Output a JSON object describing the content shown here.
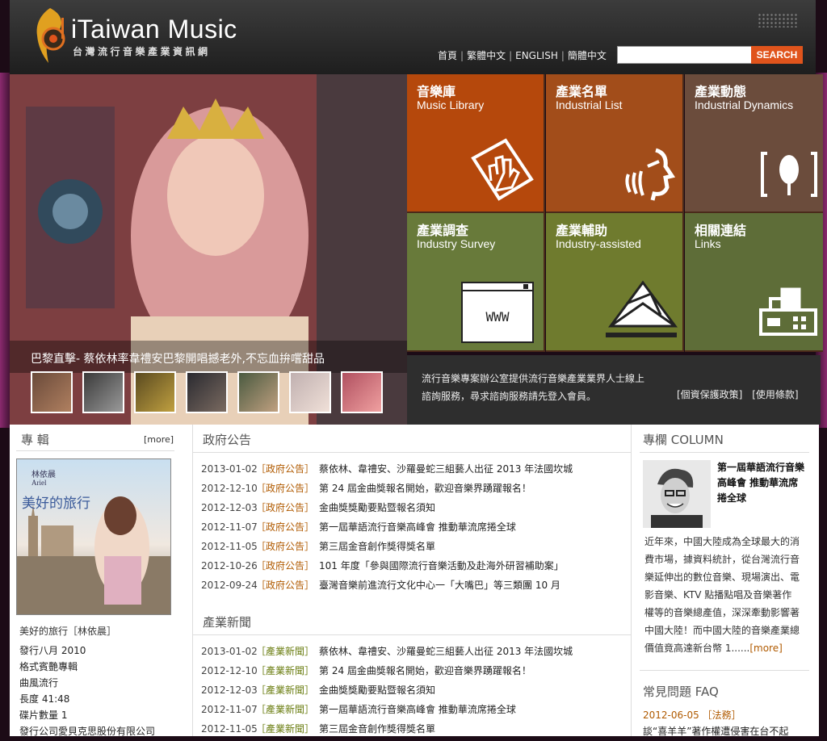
{
  "header": {
    "logo_title": "iTaiwan Music",
    "logo_subtitle": "台灣流行音樂產業資訊網",
    "nav": [
      "首頁",
      "繁體中文",
      "ENGLISH",
      "簡體中文"
    ],
    "search_placeholder": "",
    "search_button": "SEARCH"
  },
  "hero": {
    "caption": "巴黎直擊- 蔡依林率韋禮安巴黎開唱撼老外,不忘血拚嚐甜品",
    "thumbnail_count": 7
  },
  "tiles": [
    {
      "zh": "音樂庫",
      "en": "Music Library",
      "color": "#b5480c",
      "icon": "hand-icon"
    },
    {
      "zh": "產業名單",
      "en": "Industrial List",
      "color": "#a24d1a",
      "icon": "speaker-voice-icon"
    },
    {
      "zh": "產業動態",
      "en": "Industrial Dynamics",
      "color": "#6b4c3c",
      "icon": "tree-frame-icon"
    },
    {
      "zh": "產業調查",
      "en": "Industry Survey",
      "color": "#687a3a",
      "icon": "www-window-icon"
    },
    {
      "zh": "產業輔助",
      "en": "Industry-assisted",
      "color": "#6f7b2e",
      "icon": "envelope-paper-icon"
    },
    {
      "zh": "相關連結",
      "en": "Links",
      "color": "#5e6d38",
      "icon": "fax-printer-icon"
    }
  ],
  "info_bar": {
    "text": "流行音樂專案辦公室提供流行音樂產業業界人士線上諮詢服務，尋求諮詢服務請先登入會員。",
    "privacy": "[個資保護政策]",
    "terms": "[使用條款]"
  },
  "album": {
    "section_title": "專 輯",
    "more": "[more]",
    "cover_artist": "林依晨",
    "cover_en": "Ariel",
    "cover_title": "美好的旅行",
    "title": "美好的旅行［林依晨］",
    "details": [
      "發行八月 2010",
      "格式賓艷專輯",
      "曲風流行",
      "長度 41:48",
      "碟片數量 1",
      "發行公司愛貝克思股份有限公司"
    ]
  },
  "gov_notices": {
    "section_title": "政府公告",
    "tag": "［政府公告］",
    "items": [
      {
        "date": "2013-01-02",
        "title": "蔡依林、韋禮安、沙羅曼蛇三組藝人出征 2013 年法國坎城"
      },
      {
        "date": "2012-12-10",
        "title": "第 24 屆金曲獎報名開始，歡迎音樂界踴躍報名！"
      },
      {
        "date": "2012-12-03",
        "title": "金曲獎獎勵要點暨報名須知"
      },
      {
        "date": "2012-11-07",
        "title": "第一屆華語流行音樂高峰會 推動華流席捲全球"
      },
      {
        "date": "2012-11-05",
        "title": "第三屆金音創作獎得獎名單"
      },
      {
        "date": "2012-10-26",
        "title": "101 年度「參與國際流行音樂活動及赴海外研習補助案」"
      },
      {
        "date": "2012-09-24",
        "title": "臺灣音樂前進流行文化中心一「大嘴巴」等三類團 10 月"
      }
    ]
  },
  "industry_news": {
    "section_title": "產業新聞",
    "tag": "［產業新聞］",
    "items": [
      {
        "date": "2013-01-02",
        "title": "蔡依林、韋禮安、沙羅曼蛇三組藝人出征 2013 年法國坎城"
      },
      {
        "date": "2012-12-10",
        "title": "第 24 屆金曲獎報名開始，歡迎音樂界踴躍報名！"
      },
      {
        "date": "2012-12-03",
        "title": "金曲獎獎勵要點暨報名須知"
      },
      {
        "date": "2012-11-07",
        "title": "第一屆華語流行音樂高峰會 推動華流席捲全球"
      },
      {
        "date": "2012-11-05",
        "title": "第三屆金音創作獎得獎名單"
      }
    ]
  },
  "column": {
    "section_title": "專欄 COLUMN",
    "headline": "第一屆華語流行音樂高峰會 推動華流席捲全球",
    "body": "近年來，中國大陸成為全球最大的消費市場，據資料統計，從台灣流行音樂延伸出的數位音樂、現場演出、電影音樂、KTV 點播點唱及音樂著作權等的音樂總產值，深深牽動影響著中國大陸！而中國大陸的音樂產業總價值竟高達新台幣 1......",
    "more": "[more]"
  },
  "faq": {
    "section_title": "常見問題 FAQ",
    "date": "2012-06-05",
    "tag": "［法務］",
    "text": "談“喜羊羊”著作權遭侵害在台不起"
  },
  "colors": {
    "accent": "#e0541c",
    "gov_tag": "#b05a00",
    "news_tag": "#6a7d10"
  }
}
